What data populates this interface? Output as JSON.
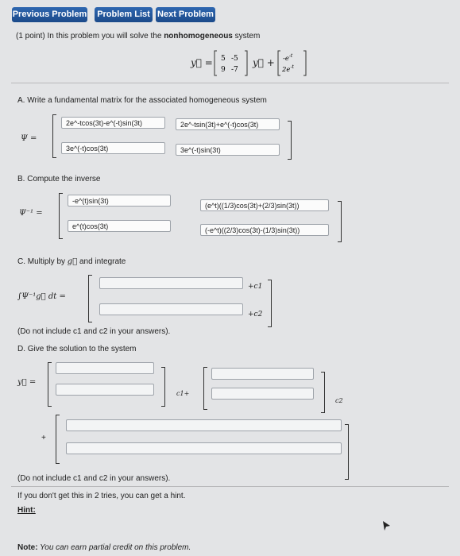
{
  "nav": {
    "previous": "Previous Problem",
    "list": "Problem List",
    "next": "Next Problem"
  },
  "intro": {
    "prefix": "(1 point) In this problem you will solve the ",
    "bold": "nonhomogeneous",
    "suffix": " system"
  },
  "system": {
    "lhs": "y⃗ =",
    "matrix": [
      "5",
      "-5",
      "9",
      "-7"
    ],
    "mid": "y⃗ +",
    "forcing": [
      "-e",
      "-t",
      "2e",
      "-t"
    ]
  },
  "partA": {
    "label": "A. Write a fundamental matrix for the associated homogeneous system",
    "symbol": "Ψ =",
    "cells": [
      "2e^-tcos(3t)-e^(-t)sin(3t)",
      "2e^-tsin(3t)+e^(-t)cos(3t)",
      "3e^(-t)cos(3t)",
      "3e^(-t)sin(3t)"
    ]
  },
  "partB": {
    "label": "B. Compute the inverse",
    "symbol": "Ψ⁻¹ =",
    "cells": [
      "-e^(t)sin(3t)",
      "(e^t)((1/3)cos(3t)+(2/3)sin(3t))",
      "e^(t)cos(3t)",
      "(-e^t)((2/3)cos(3t)-(1/3)sin(3t))"
    ]
  },
  "partC": {
    "label_prefix": "C. Multiply by ",
    "label_suffix": " and integrate",
    "integral": "∫Ψ⁻¹g⃗ dt =",
    "cells": [
      "",
      ""
    ],
    "plus_c1": "+c1",
    "plus_c2": "+c2",
    "note": "(Do not include c1 and c2 in your answers)."
  },
  "partD": {
    "label": "D. Give the solution to the system",
    "y_symbol": "y⃗ =",
    "c1": "c1+",
    "c2": "c2",
    "plus": "+",
    "cells": [
      "",
      "",
      "",
      "",
      "",
      ""
    ],
    "note": "(Do not include c1 and c2 in your answers)."
  },
  "hint_text": "If you don't get this in 2 tries, you can get a hint.",
  "hint_link": "Hint:",
  "credit": {
    "bold": "Note:",
    "text": " You can earn partial credit on this problem."
  }
}
